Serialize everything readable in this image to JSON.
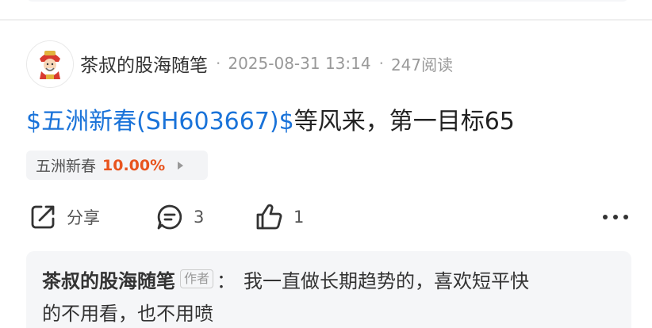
{
  "post": {
    "author": "茶叔的股海随笔",
    "separator": "·",
    "datetime": "2025-08-31 13:14",
    "views": "247阅读",
    "title_link": "$五洲新春(SH603667)$",
    "title_text": "等风来，第一目标65",
    "stock_chip": {
      "name": "五洲新春",
      "change": "10.00%"
    },
    "actions": {
      "share_label": "分享",
      "comment_count": "3",
      "like_count": "1"
    }
  },
  "reply": {
    "author": "茶叔的股海随笔",
    "tag": "作者",
    "colon": "：",
    "line1": "我一直做长期趋势的，喜欢短平快",
    "line2": "的不用看，也不用喷"
  },
  "colors": {
    "link": "#1a73d9",
    "stock_up": "#e8541e"
  },
  "icons": {
    "share": "share-icon",
    "comment": "comment-icon",
    "like": "thumbs-up-icon",
    "more": "more-icon"
  }
}
